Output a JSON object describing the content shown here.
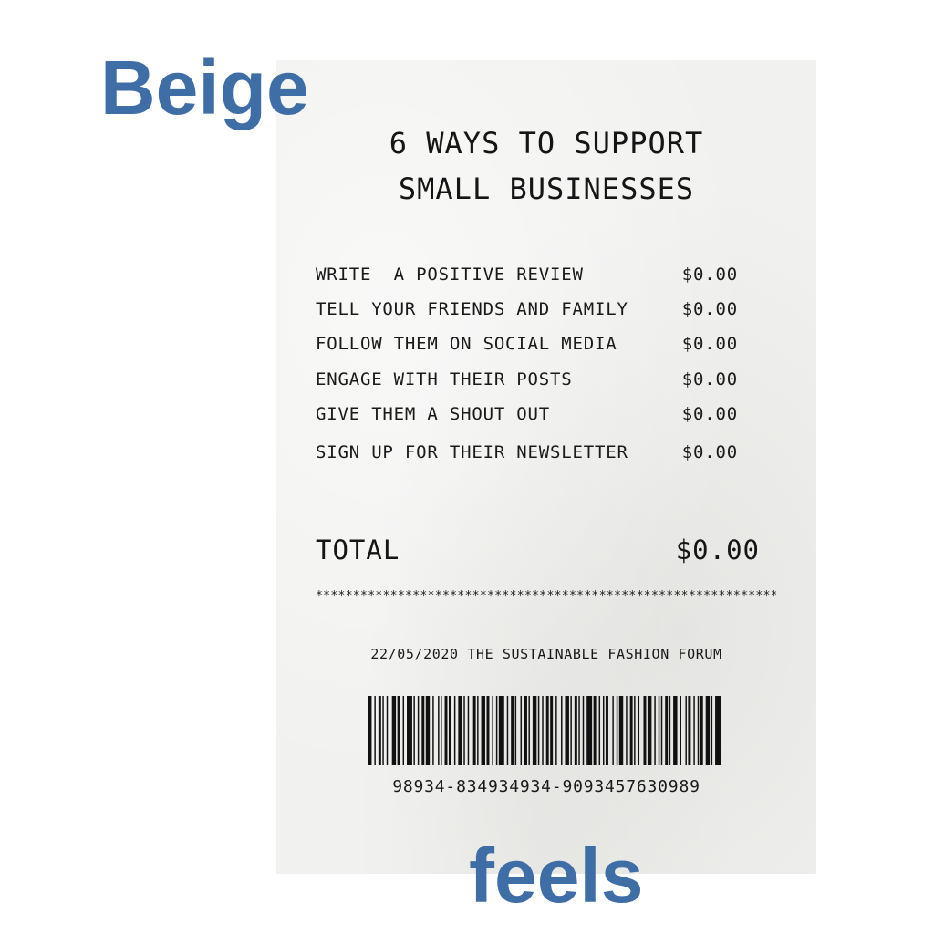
{
  "overlay": {
    "word_top": "Beige",
    "word_bottom": "feels",
    "color": "#3f6ea6"
  },
  "receipt": {
    "title_line1": "6 WAYS TO SUPPORT",
    "title_line2": "SMALL BUSINESSES",
    "items": [
      {
        "label": "WRITE  A POSITIVE REVIEW",
        "price": "$0.00"
      },
      {
        "label": "TELL YOUR FRIENDS AND FAMILY",
        "price": "$0.00"
      },
      {
        "label": "FOLLOW THEM ON SOCIAL MEDIA",
        "price": "$0.00"
      },
      {
        "label": "ENGAGE WITH THEIR POSTS",
        "price": "$0.00"
      },
      {
        "label": "GIVE THEM A SHOUT OUT",
        "price": "$0.00"
      },
      {
        "label": "SIGN UP FOR THEIR NEWSLETTER",
        "price": "$0.00"
      }
    ],
    "total_label": "TOTAL",
    "total_value": "$0.00",
    "separator": "************************************************************************",
    "footer": "22/05/2020 THE SUSTAINABLE FASHION FORUM",
    "barcode_number": "98934-834934934-9093457630989",
    "paper_color": "#f1f1ef",
    "ink_color": "#151515"
  }
}
